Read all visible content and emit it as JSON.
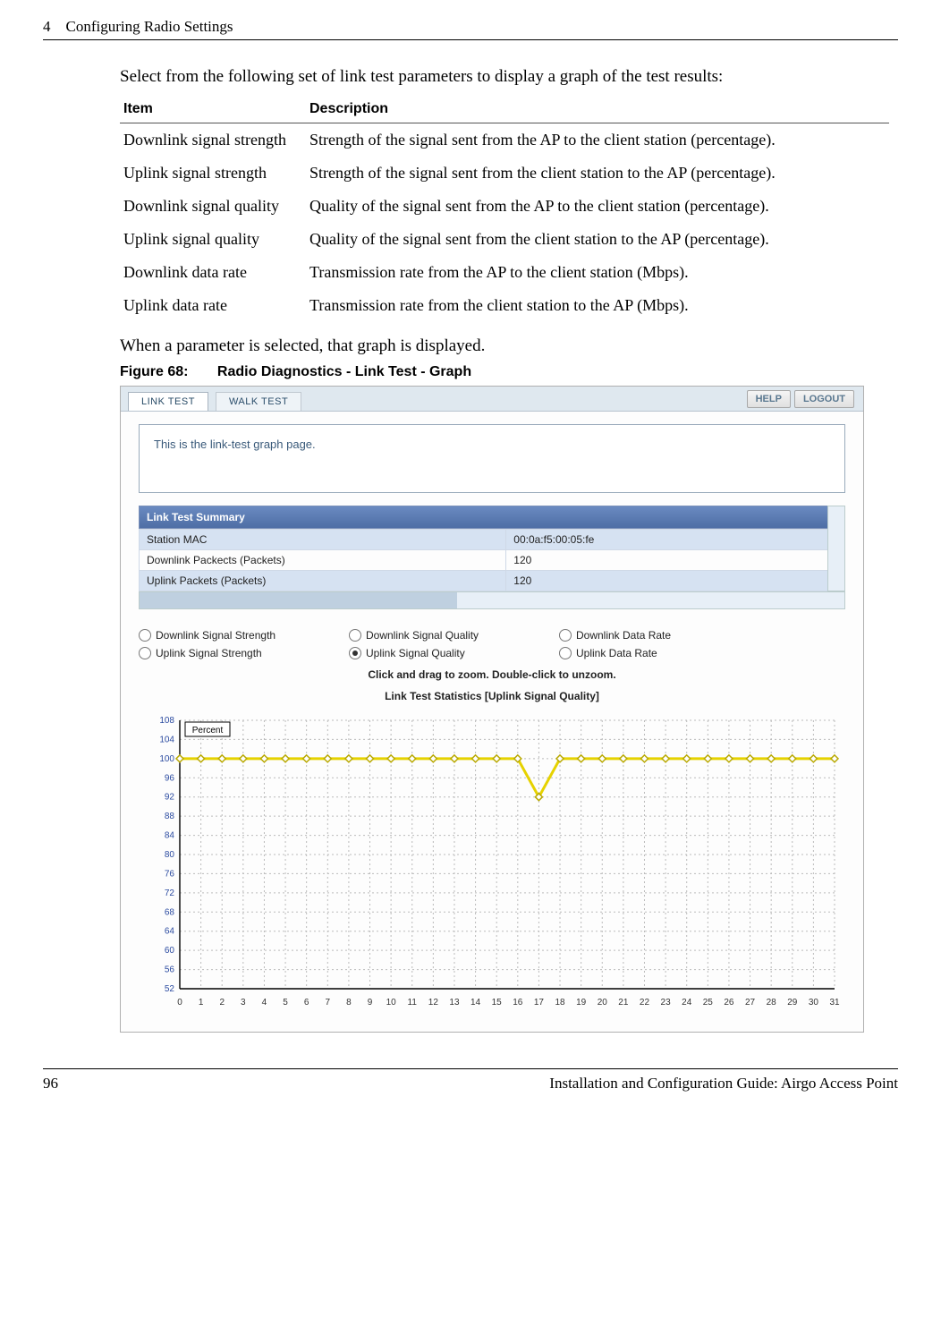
{
  "header": {
    "chapter": "4",
    "title": "Configuring Radio Settings"
  },
  "intro_text": "Select from the following set of link test parameters to display a graph of the test results:",
  "param_table": {
    "col1": "Item",
    "col2": "Description",
    "rows": [
      {
        "item": "Downlink signal strength",
        "desc": "Strength of the signal sent from the AP to the client station (percentage)."
      },
      {
        "item": "Uplink signal strength",
        "desc": "Strength of the signal sent from the client station to the AP (percentage)."
      },
      {
        "item": "Downlink signal quality",
        "desc": "Quality of the signal sent from the AP to the client station (percentage)."
      },
      {
        "item": "Uplink signal quality",
        "desc": "Quality of the signal sent from the client station to the AP (percentage)."
      },
      {
        "item": "Downlink data rate",
        "desc": "Transmission rate from the AP to the client station (Mbps)."
      },
      {
        "item": "Uplink data rate",
        "desc": "Transmission rate from the client station to the AP (Mbps)."
      }
    ]
  },
  "after_table_text": "When a parameter is selected, that graph is displayed.",
  "figure": {
    "num": "Figure 68:",
    "caption": "Radio Diagnostics - Link Test - Graph"
  },
  "screenshot": {
    "tabs": {
      "link": "LINK TEST",
      "walk": "WALK TEST"
    },
    "top_buttons": {
      "help": "HELP",
      "logout": "LOGOUT"
    },
    "info_text": "This is the link-test graph page.",
    "summary": {
      "header": "Link Test Summary",
      "rows": [
        {
          "label": "Station MAC",
          "value": "00:0a:f5:00:05:fe"
        },
        {
          "label": "Downlink Packects (Packets)",
          "value": "120"
        },
        {
          "label": "Uplink Packets (Packets)",
          "value": "120"
        }
      ]
    },
    "radios": {
      "r1": "Downlink Signal Strength",
      "r2": "Downlink Signal Quality",
      "r3": "Downlink Data Rate",
      "r4": "Uplink Signal Strength",
      "r5": "Uplink Signal Quality",
      "r6": "Uplink Data Rate"
    },
    "instruction": "Click and drag to zoom. Double-click to unzoom.",
    "chart_title": "Link Test Statistics [Uplink Signal Quality]",
    "chart_ylabel_box": "Percent"
  },
  "chart_data": {
    "type": "line",
    "title": "Link Test Statistics [Uplink Signal Quality]",
    "xlabel": "",
    "ylabel": "Percent",
    "ylim": [
      52,
      108
    ],
    "xlim": [
      0,
      31
    ],
    "series": [
      {
        "name": "Uplink Signal Quality",
        "x": [
          0,
          1,
          2,
          3,
          4,
          5,
          6,
          7,
          8,
          9,
          10,
          11,
          12,
          13,
          14,
          15,
          16,
          17,
          18,
          19,
          20,
          21,
          22,
          23,
          24,
          25,
          26,
          27,
          28,
          29,
          30,
          31
        ],
        "y": [
          100,
          100,
          100,
          100,
          100,
          100,
          100,
          100,
          100,
          100,
          100,
          100,
          100,
          100,
          100,
          100,
          100,
          92,
          100,
          100,
          100,
          100,
          100,
          100,
          100,
          100,
          100,
          100,
          100,
          100,
          100,
          100
        ]
      }
    ],
    "y_ticks": [
      52,
      56,
      60,
      64,
      68,
      72,
      76,
      80,
      84,
      88,
      92,
      96,
      100,
      104,
      108
    ],
    "x_ticks": [
      0,
      1,
      2,
      3,
      4,
      5,
      6,
      7,
      8,
      9,
      10,
      11,
      12,
      13,
      14,
      15,
      16,
      17,
      18,
      19,
      20,
      21,
      22,
      23,
      24,
      25,
      26,
      27,
      28,
      29,
      30,
      31
    ]
  },
  "footer": {
    "page": "96",
    "doc_title": "Installation and Configuration Guide: Airgo Access Point"
  }
}
